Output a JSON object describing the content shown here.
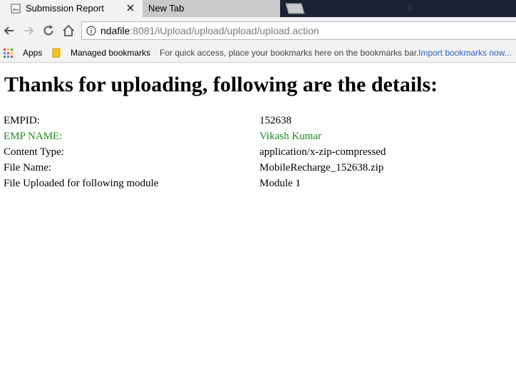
{
  "tabs": [
    {
      "title": "Submission Report",
      "active": true
    },
    {
      "title": "New Tab",
      "active": false
    }
  ],
  "address_bar": {
    "host": "ndafile",
    "rest": ":8081/iUpload/upload/upload/upload.action"
  },
  "bookmarks_bar": {
    "apps_label": "Apps",
    "managed_label": "Managed bookmarks",
    "hint": "For quick access, place your bookmarks here on the bookmarks bar.",
    "import_link": "Import bookmarks now..."
  },
  "page": {
    "heading": "Thanks for uploading, following are the details:",
    "details": [
      {
        "label": "EMPID:",
        "value": "152638"
      },
      {
        "label": "EMP NAME:",
        "value": "Vikash Kumar"
      },
      {
        "label": "Content Type:",
        "value": "application/x-zip-compressed"
      },
      {
        "label": "File Name:",
        "value": "MobileRecharge_152638.zip"
      },
      {
        "label": "File Uploaded for following module",
        "value": "Module 1"
      }
    ]
  },
  "colors": {
    "highlight_row": "#1a8a1a",
    "link": "#2a64c4",
    "tabstrip_bg": "#1b2233"
  },
  "icons": {
    "tab_favicon": "document-page-icon",
    "close": "close-icon",
    "back": "back-arrow-icon",
    "forward": "forward-arrow-icon",
    "reload": "reload-icon",
    "home": "home-icon",
    "info": "info-icon",
    "apps": "apps-grid-icon",
    "folder": "bookmark-folder-icon"
  }
}
